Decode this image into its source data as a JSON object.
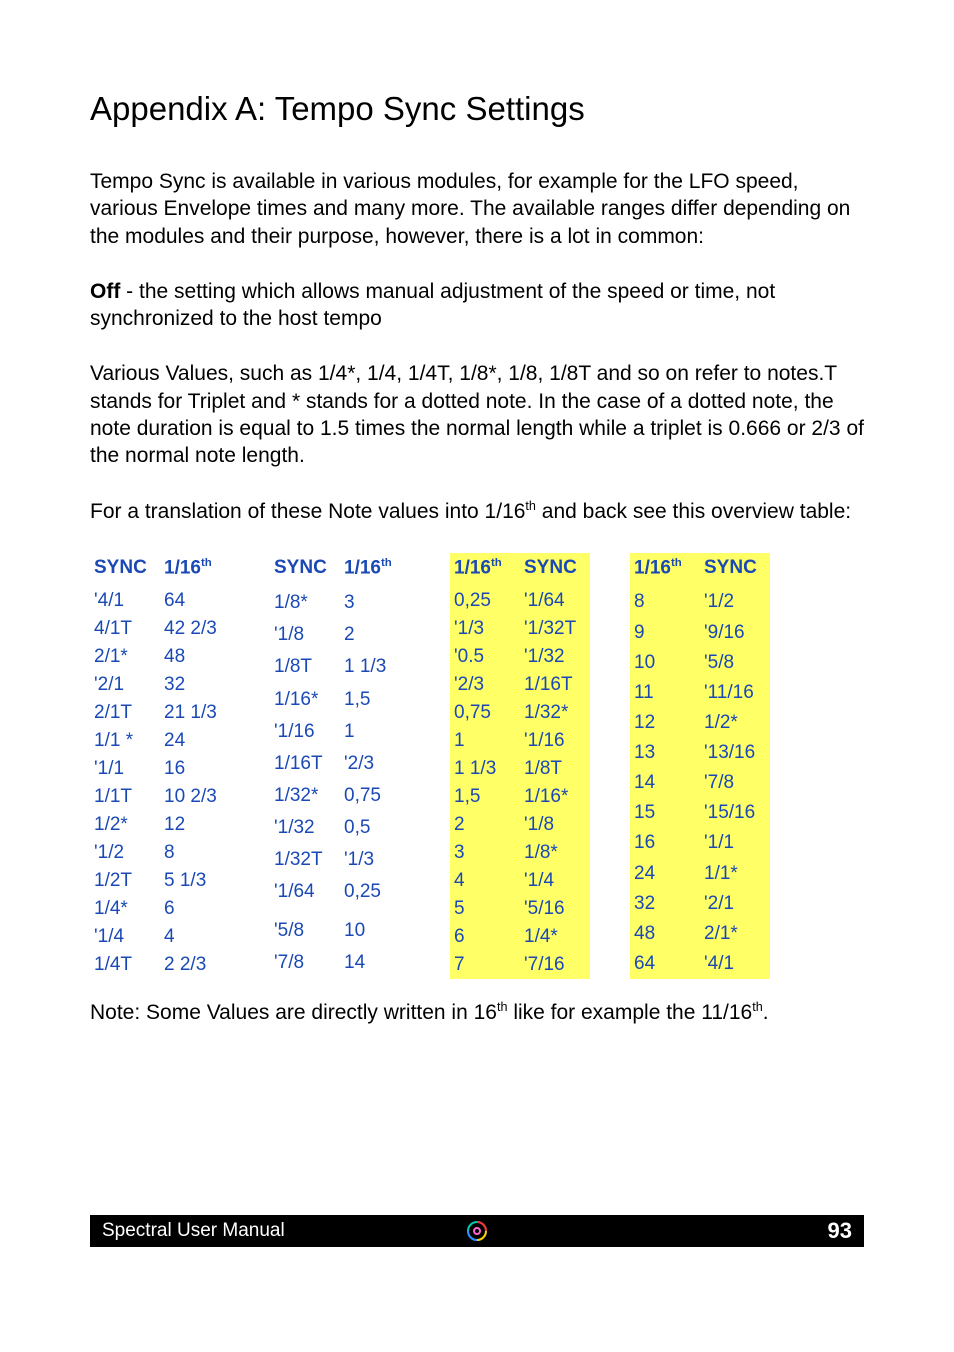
{
  "heading": "Appendix A: Tempo Sync Settings",
  "para1": "Tempo Sync is available in various modules, for example for the LFO speed, various Envelope times and many more. The available ranges differ depending on the modules and their purpose, however, there is a lot in common:",
  "para2_prefix_bold": "Off",
  "para2_rest": " - the setting which allows manual adjustment of the speed or time, not synchronized to the host tempo",
  "para3": "Various Values, such as 1/4*, 1/4, 1/4T, 1/8*, 1/8, 1/8T and so on refer to notes.T stands for Triplet and * stands for a dotted note. In the case of a dotted note, the note duration is equal to 1.5 times the normal length while a triplet is 0.666 or 2/3 of the normal note length.",
  "para4_a": "For a translation of these Note values into 1/16",
  "para4_sup": "th",
  "para4_b": " and back see this overview table:",
  "headers": {
    "sync": "SYNC",
    "sixteenth_a": "1/16",
    "sixteenth_sup": "th"
  },
  "group1": [
    [
      "'4/1",
      "64"
    ],
    [
      "4/1T",
      "42 2/3"
    ],
    [
      "2/1*",
      "48"
    ],
    [
      "'2/1",
      "32"
    ],
    [
      "2/1T",
      "21 1/3"
    ],
    [
      "1/1 *",
      "24"
    ],
    [
      "'1/1",
      "16"
    ],
    [
      "1/1T",
      "10 2/3"
    ],
    [
      "1/2*",
      "12"
    ],
    [
      "'1/2",
      "8"
    ],
    [
      "1/2T",
      "5 1/3"
    ],
    [
      "1/4*",
      "6"
    ],
    [
      "'1/4",
      "4"
    ],
    [
      "1/4T",
      "2 2/3"
    ]
  ],
  "group2": [
    [
      "1/8*",
      "3"
    ],
    [
      "'1/8",
      "2"
    ],
    [
      "1/8T",
      "1 1/3"
    ],
    [
      "1/16*",
      "1,5"
    ],
    [
      "'1/16",
      "1"
    ],
    [
      "1/16T",
      "'2/3"
    ],
    [
      "1/32*",
      "0,75"
    ],
    [
      "'1/32",
      "0,5"
    ],
    [
      "1/32T",
      "'1/3"
    ],
    [
      "'1/64",
      "0,25"
    ],
    [
      "",
      ""
    ],
    [
      "'5/8",
      "10"
    ],
    [
      "'7/8",
      "14"
    ]
  ],
  "group3": [
    [
      "0,25",
      "'1/64"
    ],
    [
      "'1/3",
      "'1/32T"
    ],
    [
      "'0.5",
      "'1/32"
    ],
    [
      "'2/3",
      "1/16T"
    ],
    [
      "0,75",
      "1/32*"
    ],
    [
      "1",
      "'1/16"
    ],
    [
      "1 1/3",
      "1/8T"
    ],
    [
      "1,5",
      "1/16*"
    ],
    [
      "2",
      "'1/8"
    ],
    [
      "3",
      "1/8*"
    ],
    [
      "4",
      "'1/4"
    ],
    [
      "5",
      "'5/16"
    ],
    [
      "6",
      "1/4*"
    ],
    [
      "7",
      "'7/16"
    ]
  ],
  "group4": [
    [
      "8",
      "'1/2"
    ],
    [
      "9",
      "'9/16"
    ],
    [
      "10",
      "'5/8"
    ],
    [
      "11",
      "'11/16"
    ],
    [
      "12",
      "1/2*"
    ],
    [
      "13",
      "'13/16"
    ],
    [
      "14",
      "'7/8"
    ],
    [
      "15",
      "'15/16"
    ],
    [
      "16",
      "'1/1"
    ],
    [
      "24",
      "1/1*"
    ],
    [
      "32",
      "'2/1"
    ],
    [
      "48",
      "2/1*"
    ],
    [
      "64",
      "'4/1"
    ]
  ],
  "note_a": "Note: Some Values are directly written in 16",
  "note_sup1": "th",
  "note_b": " like for example the 11/16",
  "note_sup2": "th",
  "note_c": ".",
  "footer": {
    "title": "Spectral User Manual",
    "page": "93"
  }
}
